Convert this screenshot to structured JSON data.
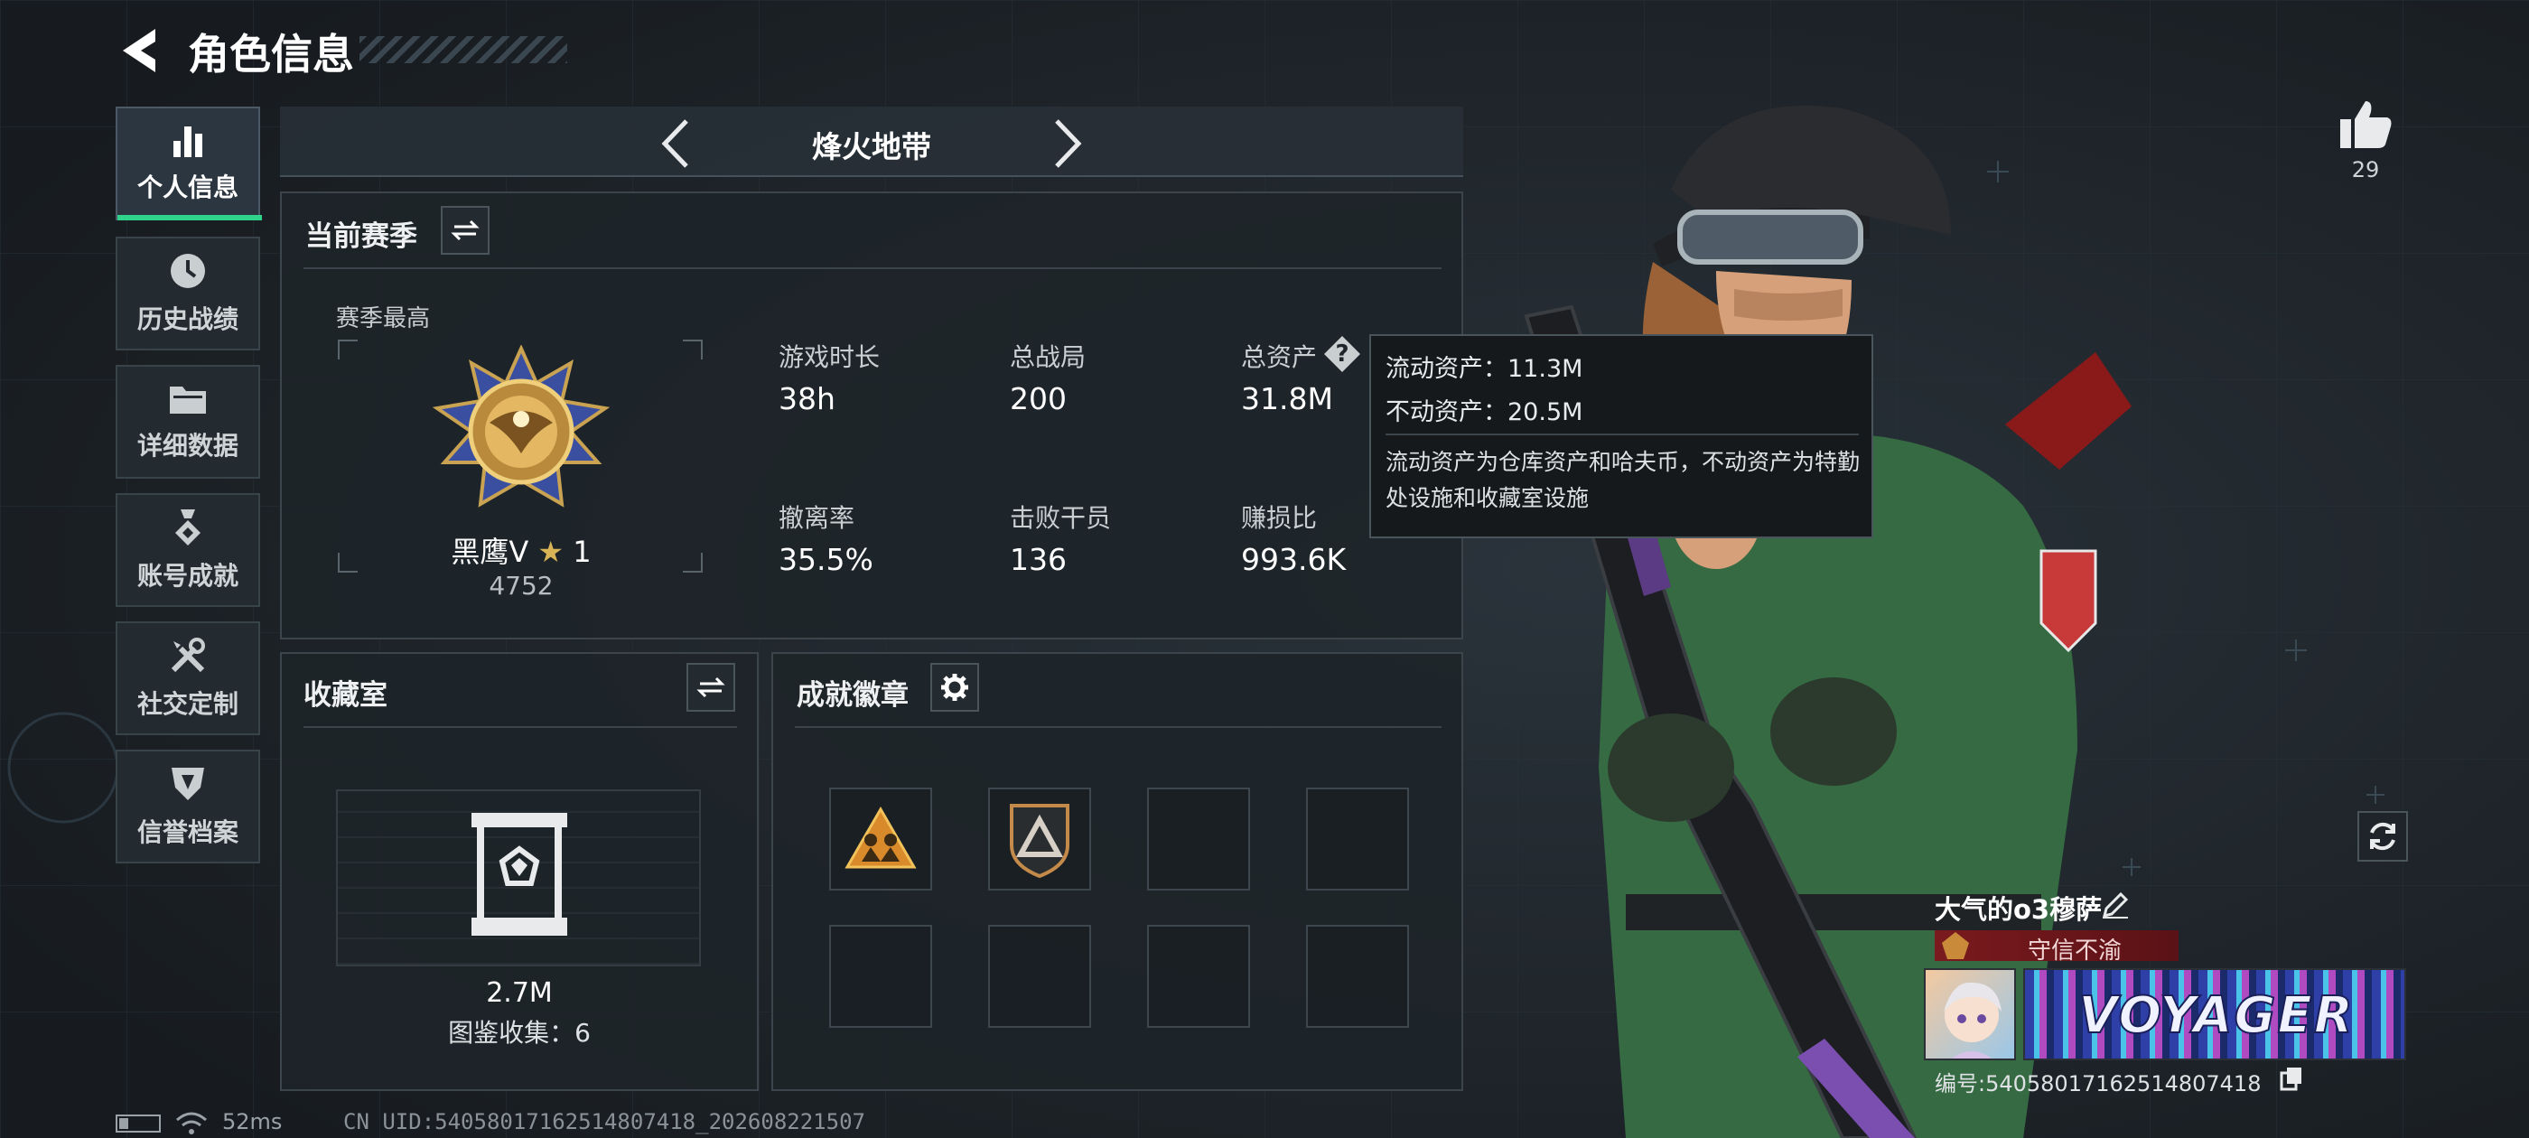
{
  "header": {
    "title": "角色信息"
  },
  "sidebar": {
    "items": [
      {
        "label": "个人信息",
        "icon": "bar-chart-icon",
        "active": true
      },
      {
        "label": "历史战绩",
        "icon": "clock-icon"
      },
      {
        "label": "详细数据",
        "icon": "folder-icon"
      },
      {
        "label": "账号成就",
        "icon": "medal-icon"
      },
      {
        "label": "社交定制",
        "icon": "tools-icon"
      },
      {
        "label": "信誉档案",
        "icon": "shield-icon"
      }
    ]
  },
  "mode_selector": {
    "label": "烽火地带"
  },
  "season": {
    "title": "当前赛季",
    "best_label": "赛季最高",
    "rank_name": "黑鹰Ⅴ",
    "stars": "1",
    "rank_score": "4752",
    "stats": [
      {
        "label": "游戏时长",
        "value": "38h"
      },
      {
        "label": "总战局",
        "value": "200"
      },
      {
        "label": "总资产",
        "value": "31.8M"
      },
      {
        "label": "撤离率",
        "value": "35.5%"
      },
      {
        "label": "击败干员",
        "value": "136"
      },
      {
        "label": "赚损比",
        "value": "993.6K"
      }
    ]
  },
  "tooltip": {
    "liquid": "流动资产：11.3M",
    "fixed": "不动资产：20.5M",
    "description": "流动资产为仓库资产和哈夫币，不动资产为特勤处设施和收藏室设施"
  },
  "collection": {
    "title": "收藏室",
    "value": "2.7M",
    "catalog": "图鉴收集：6"
  },
  "badges": {
    "title": "成就徽章"
  },
  "likes": {
    "count": "29"
  },
  "player": {
    "name": "大气的o3穆萨",
    "title_tag": "守信不渝",
    "banner_text": "VOYAGER",
    "id_text": "编号:5405801716251480741​8"
  },
  "status_bar": {
    "ping": "52ms",
    "uid": "CN UID:5405801716251480741​8_202608221507"
  },
  "colors": {
    "accent": "#2fd38c",
    "title_tag_bg": "#7a1a1e",
    "tooltip_bg": "#15191c"
  }
}
